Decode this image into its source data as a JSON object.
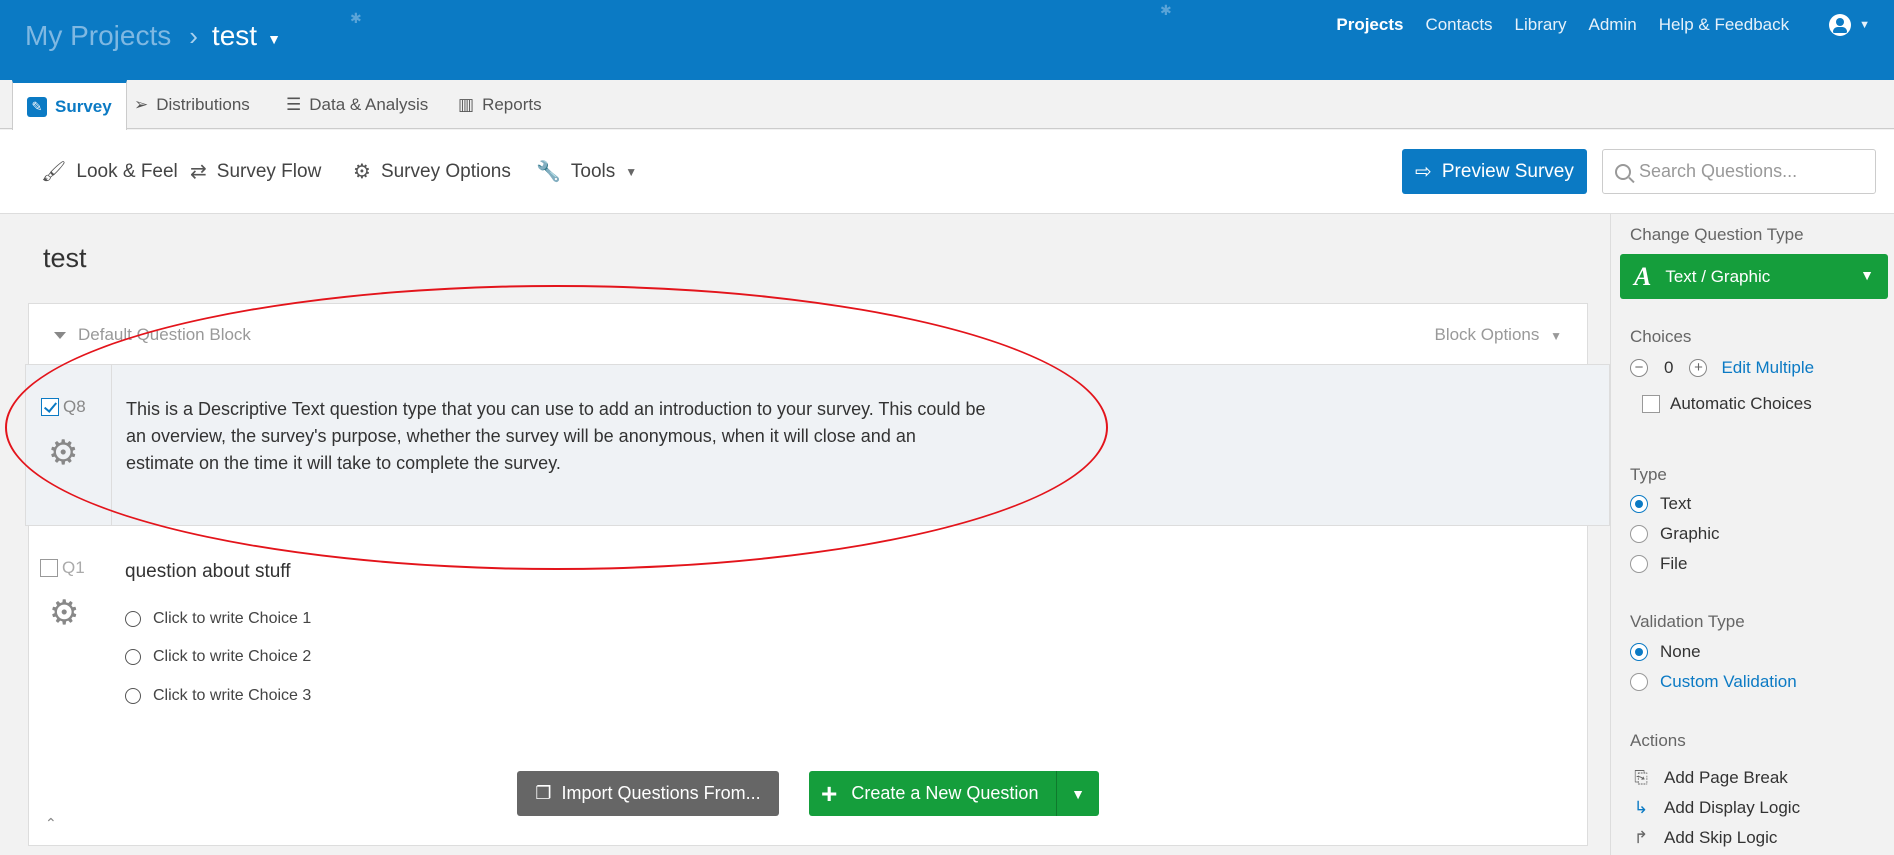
{
  "header": {
    "breadcrumb_root": "My Projects",
    "breadcrumb_current": "test",
    "nav": [
      "Projects",
      "Contacts",
      "Library",
      "Admin",
      "Help & Feedback"
    ],
    "brand_color": "#0b7ac4"
  },
  "tabs": [
    {
      "label": "Survey",
      "icon": "pencil-icon",
      "active": true
    },
    {
      "label": "Distributions",
      "icon": "paper-plane-icon"
    },
    {
      "label": "Data & Analysis",
      "icon": "document-icon"
    },
    {
      "label": "Reports",
      "icon": "bar-chart-icon"
    }
  ],
  "toolbar": {
    "look_feel": "Look & Feel",
    "survey_flow": "Survey Flow",
    "survey_options": "Survey Options",
    "tools": "Tools",
    "preview": "Preview Survey",
    "search_placeholder": "Search Questions..."
  },
  "survey": {
    "title": "test",
    "block_name": "Default Question Block",
    "block_options": "Block Options",
    "questions": [
      {
        "id": "Q8",
        "selected": true,
        "text": "This is a Descriptive Text question type that you can use to add an introduction to your survey. This could be an overview, the survey's purpose, whether the survey will be anonymous, when it will close and an estimate on the time it will take to complete the survey."
      },
      {
        "id": "Q1",
        "selected": false,
        "text": "question about stuff",
        "choices": [
          "Click to write Choice 1",
          "Click to write Choice 2",
          "Click to write Choice 3"
        ]
      }
    ],
    "import_button": "Import Questions From...",
    "create_button": "Create a New Question"
  },
  "panel": {
    "change_type_heading": "Change Question Type",
    "type_button": "Text / Graphic",
    "choices_heading": "Choices",
    "choices_count": "0",
    "edit_multiple": "Edit Multiple",
    "automatic_choices": "Automatic Choices",
    "type_heading": "Type",
    "type_options": [
      "Text",
      "Graphic",
      "File"
    ],
    "type_selected": "Text",
    "validation_heading": "Validation Type",
    "validation_none": "None",
    "validation_custom": "Custom Validation",
    "actions_heading": "Actions",
    "actions": [
      "Add Page Break",
      "Add Display Logic",
      "Add Skip Logic"
    ],
    "action_color": "#159e3c"
  }
}
